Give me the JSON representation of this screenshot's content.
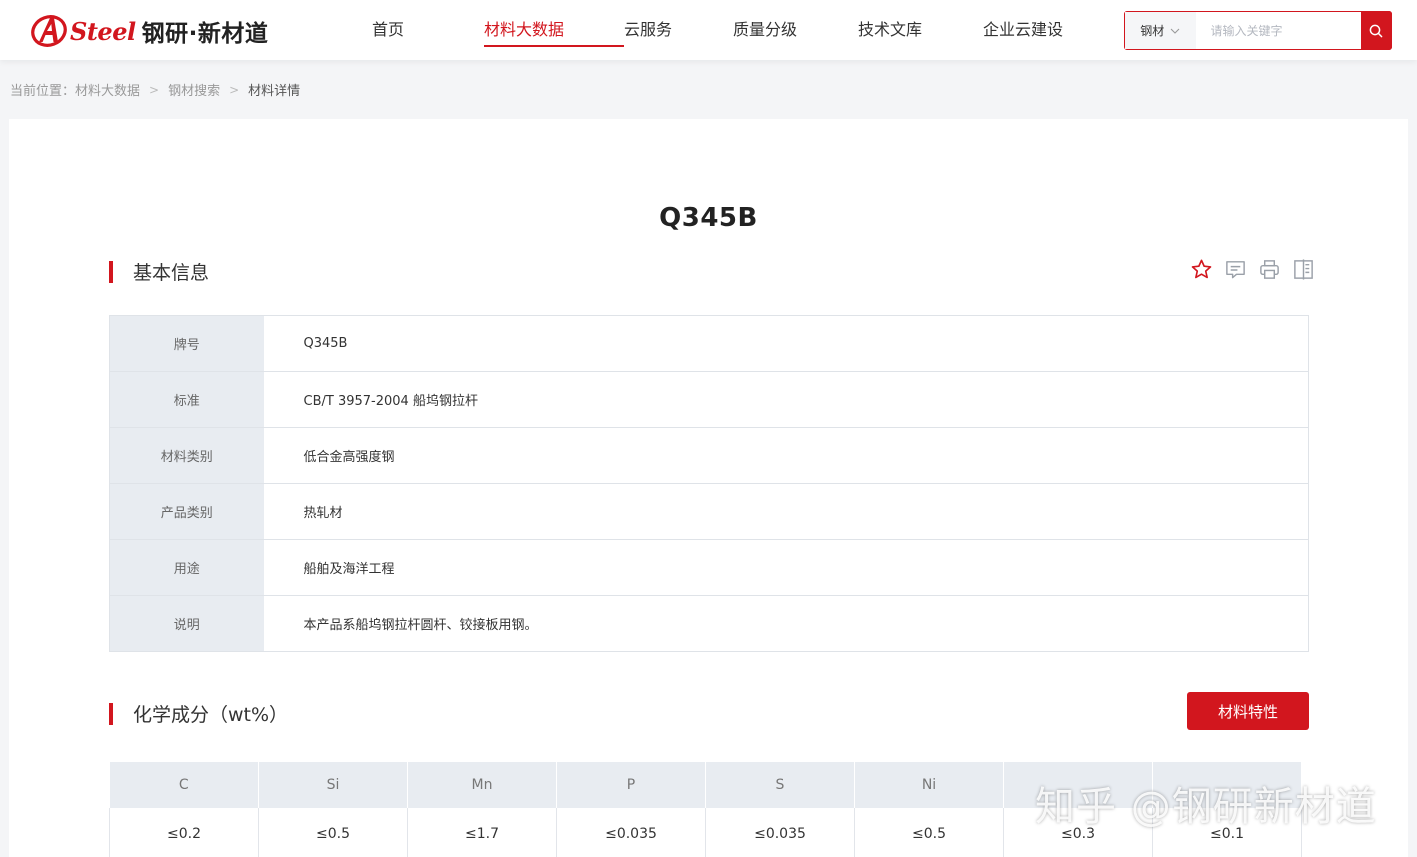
{
  "header": {
    "logo_text": "Steel",
    "logo_cn": "钢研·新材道",
    "nav": [
      {
        "label": "首页",
        "active": false
      },
      {
        "label": "材料大数据",
        "active": true
      },
      {
        "label": "云服务",
        "active": false
      },
      {
        "label": "质量分级",
        "active": false
      },
      {
        "label": "技术文库",
        "active": false
      },
      {
        "label": "企业云建设",
        "active": false
      }
    ],
    "search": {
      "category": "钢材",
      "placeholder": "请输入关键字"
    }
  },
  "breadcrumb": {
    "prefix": "当前位置：",
    "items": [
      "材料大数据",
      "钢材搜索"
    ],
    "current": "材料详情"
  },
  "material": {
    "title": "Q345B"
  },
  "basic_info": {
    "heading": "基本信息",
    "rows": [
      {
        "key": "牌号",
        "value": "Q345B"
      },
      {
        "key": "标准",
        "value": "CB/T 3957-2004 船坞钢拉杆"
      },
      {
        "key": "材料类别",
        "value": "低合金高强度钢"
      },
      {
        "key": "产品类别",
        "value": "热轧材"
      },
      {
        "key": "用途",
        "value": "船舶及海洋工程"
      },
      {
        "key": "说明",
        "value": "本产品系船坞钢拉杆圆杆、铰接板用钢。"
      }
    ],
    "tools": [
      "star-icon",
      "comment-icon",
      "print-icon",
      "compare-icon"
    ]
  },
  "chemistry": {
    "heading": "化学成分（wt%）",
    "button_label": "材料特性",
    "columns": [
      "C",
      "Si",
      "Mn",
      "P",
      "S",
      "Ni",
      "",
      ""
    ],
    "values": [
      "≤0.2",
      "≤0.5",
      "≤1.7",
      "≤0.035",
      "≤0.035",
      "≤0.5",
      "≤0.3",
      "≤0.1"
    ]
  },
  "watermark": "知乎 @钢研新材道",
  "colors": {
    "brand_red": "#d2161e",
    "label_bg": "#e8ecf1"
  }
}
